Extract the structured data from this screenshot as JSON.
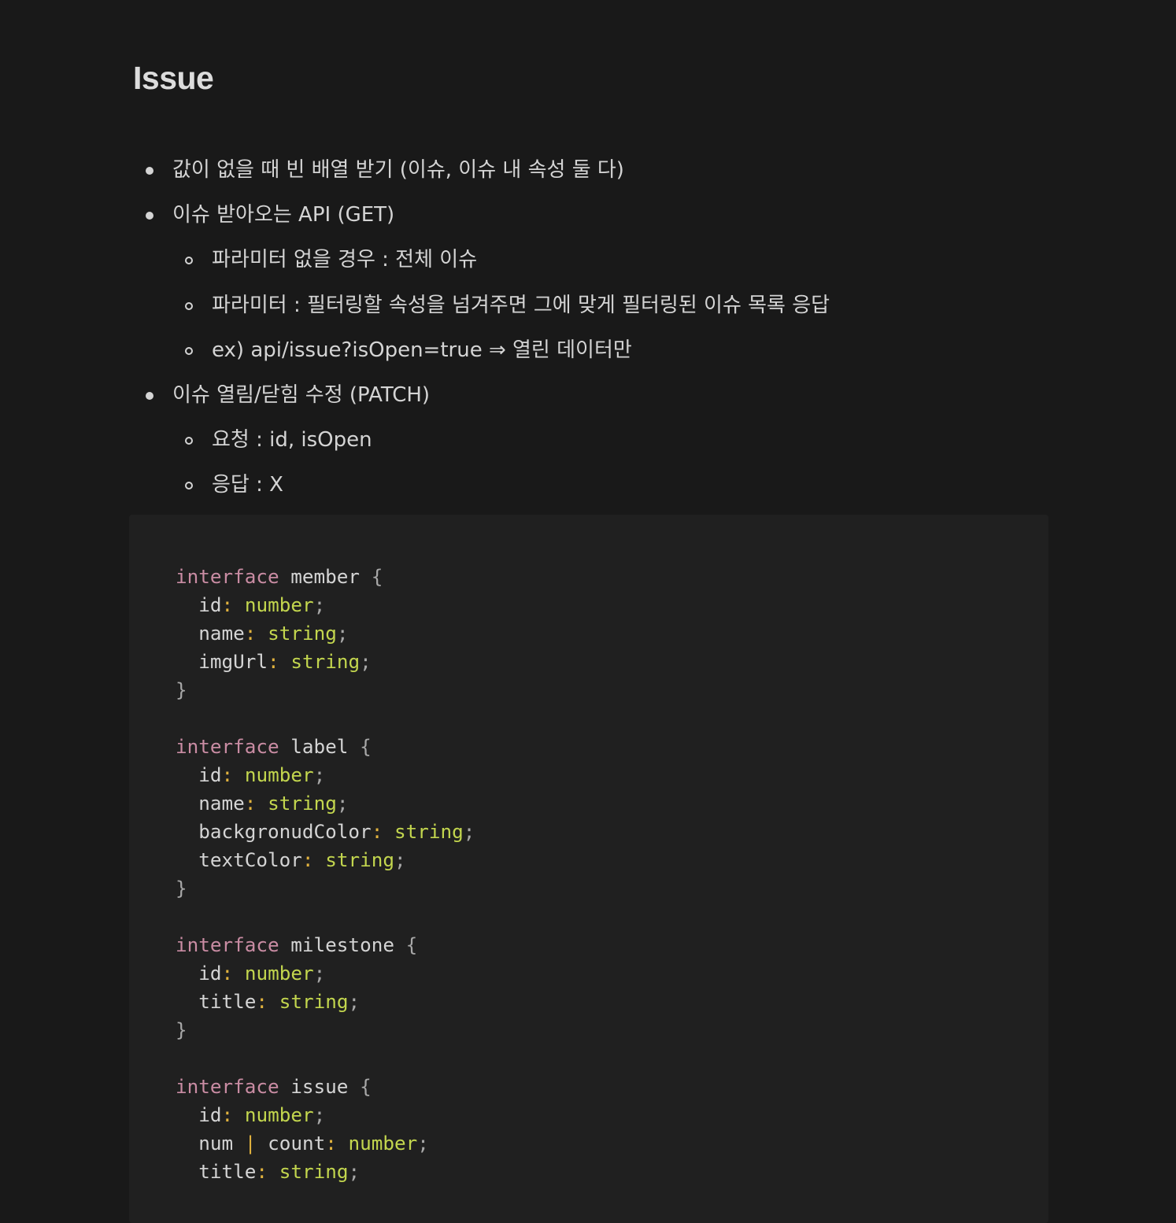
{
  "title": "Issue",
  "bullets": [
    {
      "level": 1,
      "text": "값이 없을 때 빈 배열 받기 (이슈, 이슈 내 속성 둘 다)"
    },
    {
      "level": 1,
      "text": "이슈 받아오는 API (GET)"
    },
    {
      "level": 2,
      "text": "파라미터 없을 경우 : 전체 이슈"
    },
    {
      "level": 2,
      "text": "파라미터 : 필터링할 속성을 넘겨주면 그에 맞게 필터링된 이슈 목록 응답"
    },
    {
      "level": 2,
      "text": "ex) api/issue?isOpen=true ⇒ 열린 데이터만"
    },
    {
      "level": 1,
      "text": "이슈 열림/닫힘 수정 (PATCH)"
    },
    {
      "level": 2,
      "text": "요청 : id, isOpen"
    },
    {
      "level": 2,
      "text": "응답 : X"
    }
  ],
  "code": {
    "keyword": "interface",
    "blocks": [
      {
        "name": "member",
        "fields": [
          {
            "key": "id",
            "type": "number"
          },
          {
            "key": "name",
            "type": "string"
          },
          {
            "key": "imgUrl",
            "type": "string"
          }
        ]
      },
      {
        "name": "label",
        "fields": [
          {
            "key": "id",
            "type": "number"
          },
          {
            "key": "name",
            "type": "string"
          },
          {
            "key": "backgronudColor",
            "type": "string"
          },
          {
            "key": "textColor",
            "type": "string"
          }
        ]
      },
      {
        "name": "milestone",
        "fields": [
          {
            "key": "id",
            "type": "number"
          },
          {
            "key": "title",
            "type": "string"
          }
        ]
      },
      {
        "name": "issue",
        "fields": [
          {
            "key": "id",
            "type": "number"
          },
          {
            "key": "num",
            "union": "count",
            "type": "number"
          },
          {
            "key": "title",
            "type": "string"
          }
        ]
      }
    ]
  },
  "colors": {
    "background": "#191919",
    "code_background": "#202020",
    "keyword": "#c98ca3",
    "type": "#c3d64e",
    "punctuation": "#e1b23e"
  }
}
